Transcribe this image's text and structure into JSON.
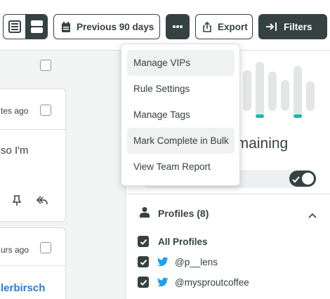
{
  "toolbar": {
    "view_toggle": {
      "left_icon": "list-icon",
      "right_icon": "stacked-view-icon",
      "selected": "right"
    },
    "date_range_label": "Previous 90 days",
    "date_icon": "calendar-icon",
    "more_icon": "more-horizontal-icon",
    "export_label": "Export",
    "export_icon": "share-icon",
    "filters_label": "Filters",
    "filters_icon": "arrow-to-right-icon"
  },
  "messages": [
    {
      "time": "tes ago",
      "body": "so I'm",
      "actions": [
        "pin-icon",
        "reply-icon"
      ]
    },
    {
      "time": "urs ago",
      "author": "lerbirsch"
    }
  ],
  "side_panel": {
    "remaining_label": "emaining",
    "sla_toggle_on": true,
    "profiles_header": "Profiles (8)",
    "profiles_icon": "person-icon",
    "profiles": [
      {
        "label": "All Profiles",
        "checked": true,
        "network": ""
      },
      {
        "label": "@p__lens",
        "checked": true,
        "network": "twitter"
      },
      {
        "label": "@mysproutcoffee",
        "checked": true,
        "network": "twitter"
      }
    ]
  },
  "more_menu": {
    "items": [
      {
        "label": "Manage VIPs",
        "highlighted": true
      },
      {
        "label": "Rule Settings",
        "highlighted": false
      },
      {
        "label": "Manage Tags",
        "highlighted": false
      },
      {
        "label": "Mark Complete in Bulk",
        "highlighted": true
      },
      {
        "label": "View Team Report",
        "highlighted": false
      }
    ]
  },
  "colors": {
    "primary_dark": "#364141",
    "teal_accent": "#1ab9b0",
    "twitter_blue": "#1da1f2",
    "link_blue": "#2b7bd3",
    "border": "#dcdfe0"
  }
}
